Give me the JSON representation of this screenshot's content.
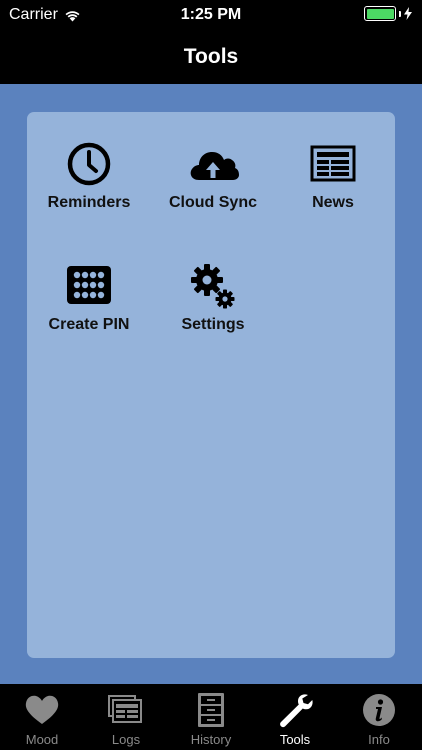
{
  "status_bar": {
    "carrier": "Carrier",
    "time": "1:25 PM",
    "battery_color": "#4cd964",
    "icons": [
      "wifi-icon",
      "battery-icon",
      "charging-bolt-icon"
    ]
  },
  "nav_bar": {
    "title": "Tools"
  },
  "colors": {
    "background": "#5b82be",
    "panel": "#95b3da",
    "bars": "#000000",
    "active_tab": "#ffffff",
    "inactive_tab": "#8a8a8a"
  },
  "tools": [
    {
      "label": "Reminders",
      "icon": "clock-icon"
    },
    {
      "label": "Cloud Sync",
      "icon": "cloud-upload-icon"
    },
    {
      "label": "News",
      "icon": "newspaper-icon"
    },
    {
      "label": "Create PIN",
      "icon": "keypad-icon"
    },
    {
      "label": "Settings",
      "icon": "gears-icon"
    }
  ],
  "tabs": [
    {
      "label": "Mood",
      "icon": "heart-icon",
      "active": false
    },
    {
      "label": "Logs",
      "icon": "logs-icon",
      "active": false
    },
    {
      "label": "History",
      "icon": "file-cabinet-icon",
      "active": false
    },
    {
      "label": "Tools",
      "icon": "wrench-icon",
      "active": true
    },
    {
      "label": "Info",
      "icon": "info-icon",
      "active": false
    }
  ]
}
